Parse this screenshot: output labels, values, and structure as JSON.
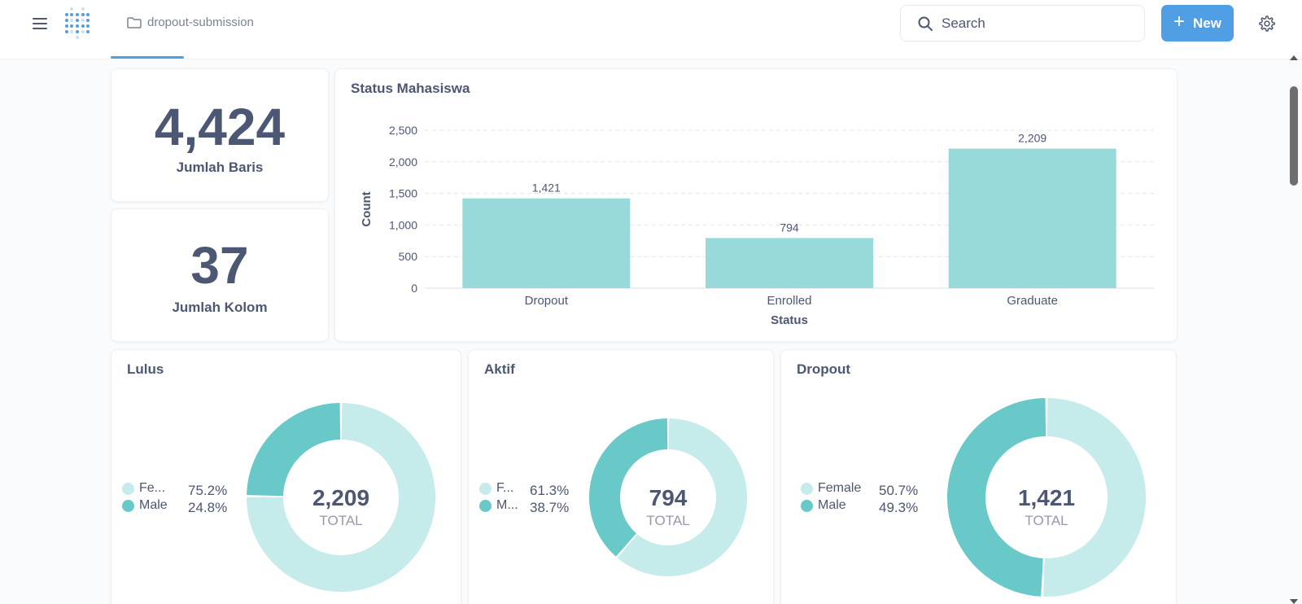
{
  "header": {
    "breadcrumb": "dropout-submission",
    "search_placeholder": "Search",
    "new_label": "New"
  },
  "colors": {
    "accent": "#509ee3",
    "bar": "#98d9d9",
    "donut_light": "#c5ebea",
    "donut_dark": "#69c8c8",
    "text": "#4c5773"
  },
  "scalars": [
    {
      "value": "4,424",
      "label": "Jumlah Baris"
    },
    {
      "value": "37",
      "label": "Jumlah Kolom"
    }
  ],
  "bar_card": {
    "title": "Status Mahasiswa"
  },
  "donut_cards": [
    {
      "title": "Lulus",
      "center_value": "2,209",
      "center_label": "TOTAL",
      "legend": [
        {
          "label": "Fe...",
          "pct": "75.2%"
        },
        {
          "label": "Male",
          "pct": "24.8%"
        }
      ]
    },
    {
      "title": "Aktif",
      "center_value": "794",
      "center_label": "TOTAL",
      "legend": [
        {
          "label": "F...",
          "pct": "61.3%"
        },
        {
          "label": "M...",
          "pct": "38.7%"
        }
      ]
    },
    {
      "title": "Dropout",
      "center_value": "1,421",
      "center_label": "TOTAL",
      "legend": [
        {
          "label": "Female",
          "pct": "50.7%"
        },
        {
          "label": "Male",
          "pct": "49.3%"
        }
      ]
    }
  ],
  "chart_data": [
    {
      "type": "bar",
      "title": "Status Mahasiswa",
      "xlabel": "Status",
      "ylabel": "Count",
      "categories": [
        "Dropout",
        "Enrolled",
        "Graduate"
      ],
      "values": [
        1421,
        794,
        2209
      ],
      "value_labels": [
        "1,421",
        "794",
        "2,209"
      ],
      "ylim": [
        0,
        2500
      ],
      "yticks": [
        0,
        500,
        1000,
        1500,
        2000,
        2500
      ],
      "ytick_labels": [
        "0",
        "500",
        "1,000",
        "1,500",
        "2,000",
        "2,500"
      ],
      "grid": true,
      "color": "#98d9d9"
    },
    {
      "type": "pie",
      "title": "Lulus",
      "labels": [
        "Female",
        "Male"
      ],
      "values": [
        75.2,
        24.8
      ],
      "colors": [
        "#c5ebea",
        "#69c8c8"
      ],
      "total": 2209
    },
    {
      "type": "pie",
      "title": "Aktif",
      "labels": [
        "Female",
        "Male"
      ],
      "values": [
        61.3,
        38.7
      ],
      "colors": [
        "#c5ebea",
        "#69c8c8"
      ],
      "total": 794
    },
    {
      "type": "pie",
      "title": "Dropout",
      "labels": [
        "Female",
        "Male"
      ],
      "values": [
        50.7,
        49.3
      ],
      "colors": [
        "#c5ebea",
        "#69c8c8"
      ],
      "total": 1421
    }
  ]
}
